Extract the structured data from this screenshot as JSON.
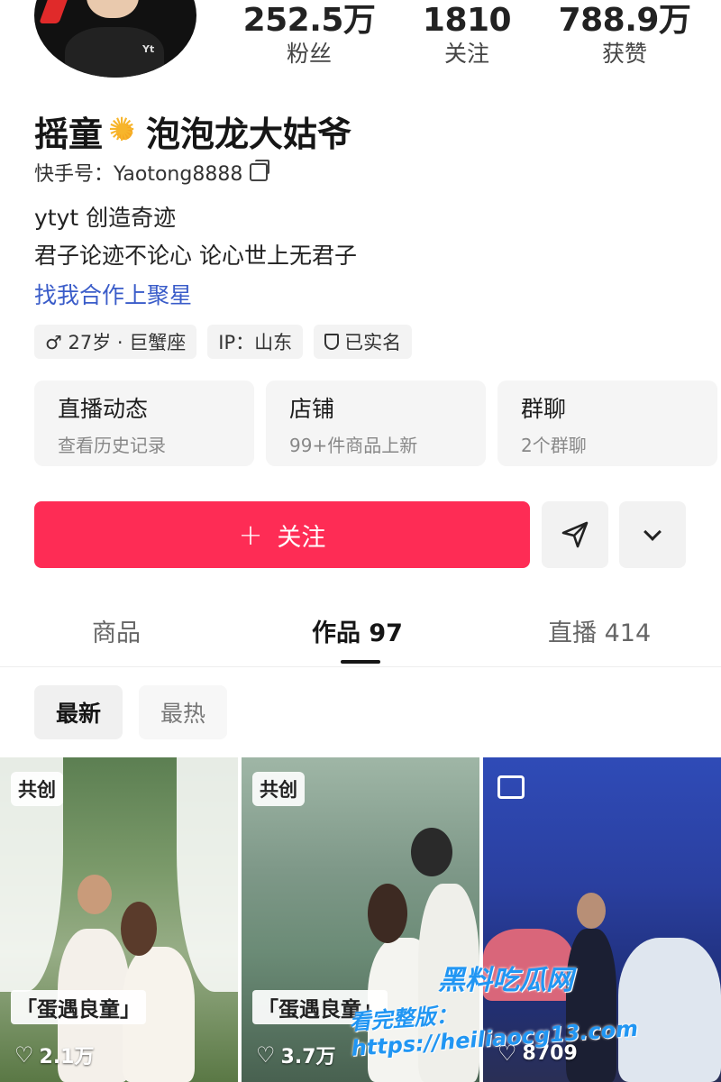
{
  "profile": {
    "name": "摇童",
    "name_suffix": "泡泡龙大姑爷",
    "account_label": "快手号：Yaotong8888",
    "bio_line1": "ytyt   创造奇迹",
    "bio_line2": "君子论迹不论心  论心世上无君子",
    "bio_link": "找我合作上聚星"
  },
  "stats": [
    {
      "value": "252.5万",
      "label": "粉丝"
    },
    {
      "value": "1810",
      "label": "关注"
    },
    {
      "value": "788.9万",
      "label": "获赞"
    }
  ],
  "avatar_tag": "Yt",
  "tags": [
    {
      "label": "♂ 27岁 · 巨蟹座"
    },
    {
      "label": "IP：山东"
    },
    {
      "label": "已实名"
    }
  ],
  "cards": [
    {
      "title": "直播动态",
      "sub": "查看历史记录"
    },
    {
      "title": "店铺",
      "sub": "99+件商品上新"
    },
    {
      "title": "群聊",
      "sub": "2个群聊"
    }
  ],
  "follow_button": {
    "plus": "+",
    "label": "关注"
  },
  "tabs": [
    {
      "label": "商品"
    },
    {
      "label": "作品 97"
    },
    {
      "label": "直播 414"
    }
  ],
  "sort": {
    "latest": "最新",
    "hottest": "最热"
  },
  "videos": [
    {
      "badge": "共创",
      "caption": "「蛋遇良童」",
      "likes": "2.1万"
    },
    {
      "badge": "共创",
      "caption": "「蛋遇良童」",
      "likes": "3.7万"
    },
    {
      "badge": "",
      "caption": "",
      "likes": "8709"
    }
  ],
  "watermark": {
    "brand": "黑料吃瓜网",
    "line": "看完整版：https://heiliaocg13.com"
  },
  "colors": {
    "accent": "#fe2c55",
    "link": "#3a5cc9"
  },
  "icons": [
    "copy-icon",
    "shield-icon",
    "send-icon",
    "chevron-down-icon",
    "heart-icon",
    "image-icon",
    "sun-icon"
  ]
}
